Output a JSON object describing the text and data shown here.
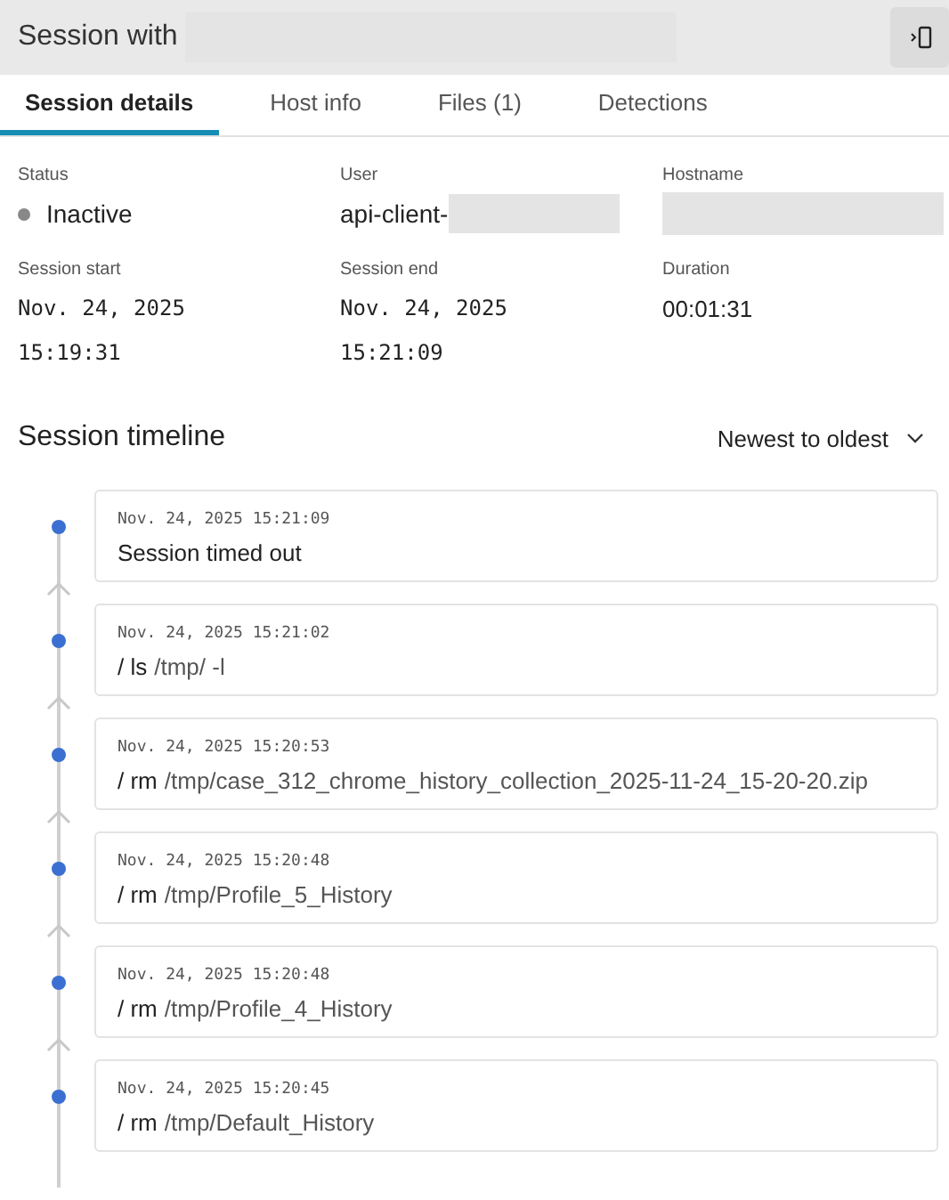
{
  "header": {
    "title": "Session with"
  },
  "tabs": [
    {
      "label": "Session details",
      "selected": true
    },
    {
      "label": "Host info",
      "selected": false
    },
    {
      "label": "Files (1)",
      "selected": false
    },
    {
      "label": "Detections",
      "selected": false
    }
  ],
  "details": {
    "status": {
      "label": "Status",
      "value": "Inactive",
      "active": false
    },
    "user": {
      "label": "User",
      "value": "api-client-"
    },
    "hostname": {
      "label": "Hostname"
    },
    "session_start": {
      "label": "Session start",
      "date": "Nov. 24, 2025",
      "time": "15:19:31"
    },
    "session_end": {
      "label": "Session end",
      "date": "Nov. 24, 2025",
      "time": "15:21:09"
    },
    "duration": {
      "label": "Duration",
      "value": "00:01:31"
    }
  },
  "timeline": {
    "title": "Session timeline",
    "sort": "Newest to oldest",
    "events": [
      {
        "kind": "message",
        "time": "Nov. 24, 2025 15:21:09",
        "text": "Session timed out"
      },
      {
        "kind": "command",
        "time": "Nov. 24, 2025 15:21:02",
        "command": "/ ls",
        "args": "/tmp/ -l"
      },
      {
        "kind": "command",
        "time": "Nov. 24, 2025 15:20:53",
        "command": "/ rm",
        "args": "/tmp/case_312_chrome_history_collection_2025-11-24_15-20-20.zip"
      },
      {
        "kind": "command",
        "time": "Nov. 24, 2025 15:20:48",
        "command": "/ rm",
        "args": "/tmp/Profile_5_History"
      },
      {
        "kind": "command",
        "time": "Nov. 24, 2025 15:20:48",
        "command": "/ rm",
        "args": "/tmp/Profile_4_History"
      },
      {
        "kind": "command",
        "time": "Nov. 24, 2025 15:20:45",
        "command": "/ rm",
        "args": "/tmp/Default_History"
      }
    ]
  }
}
